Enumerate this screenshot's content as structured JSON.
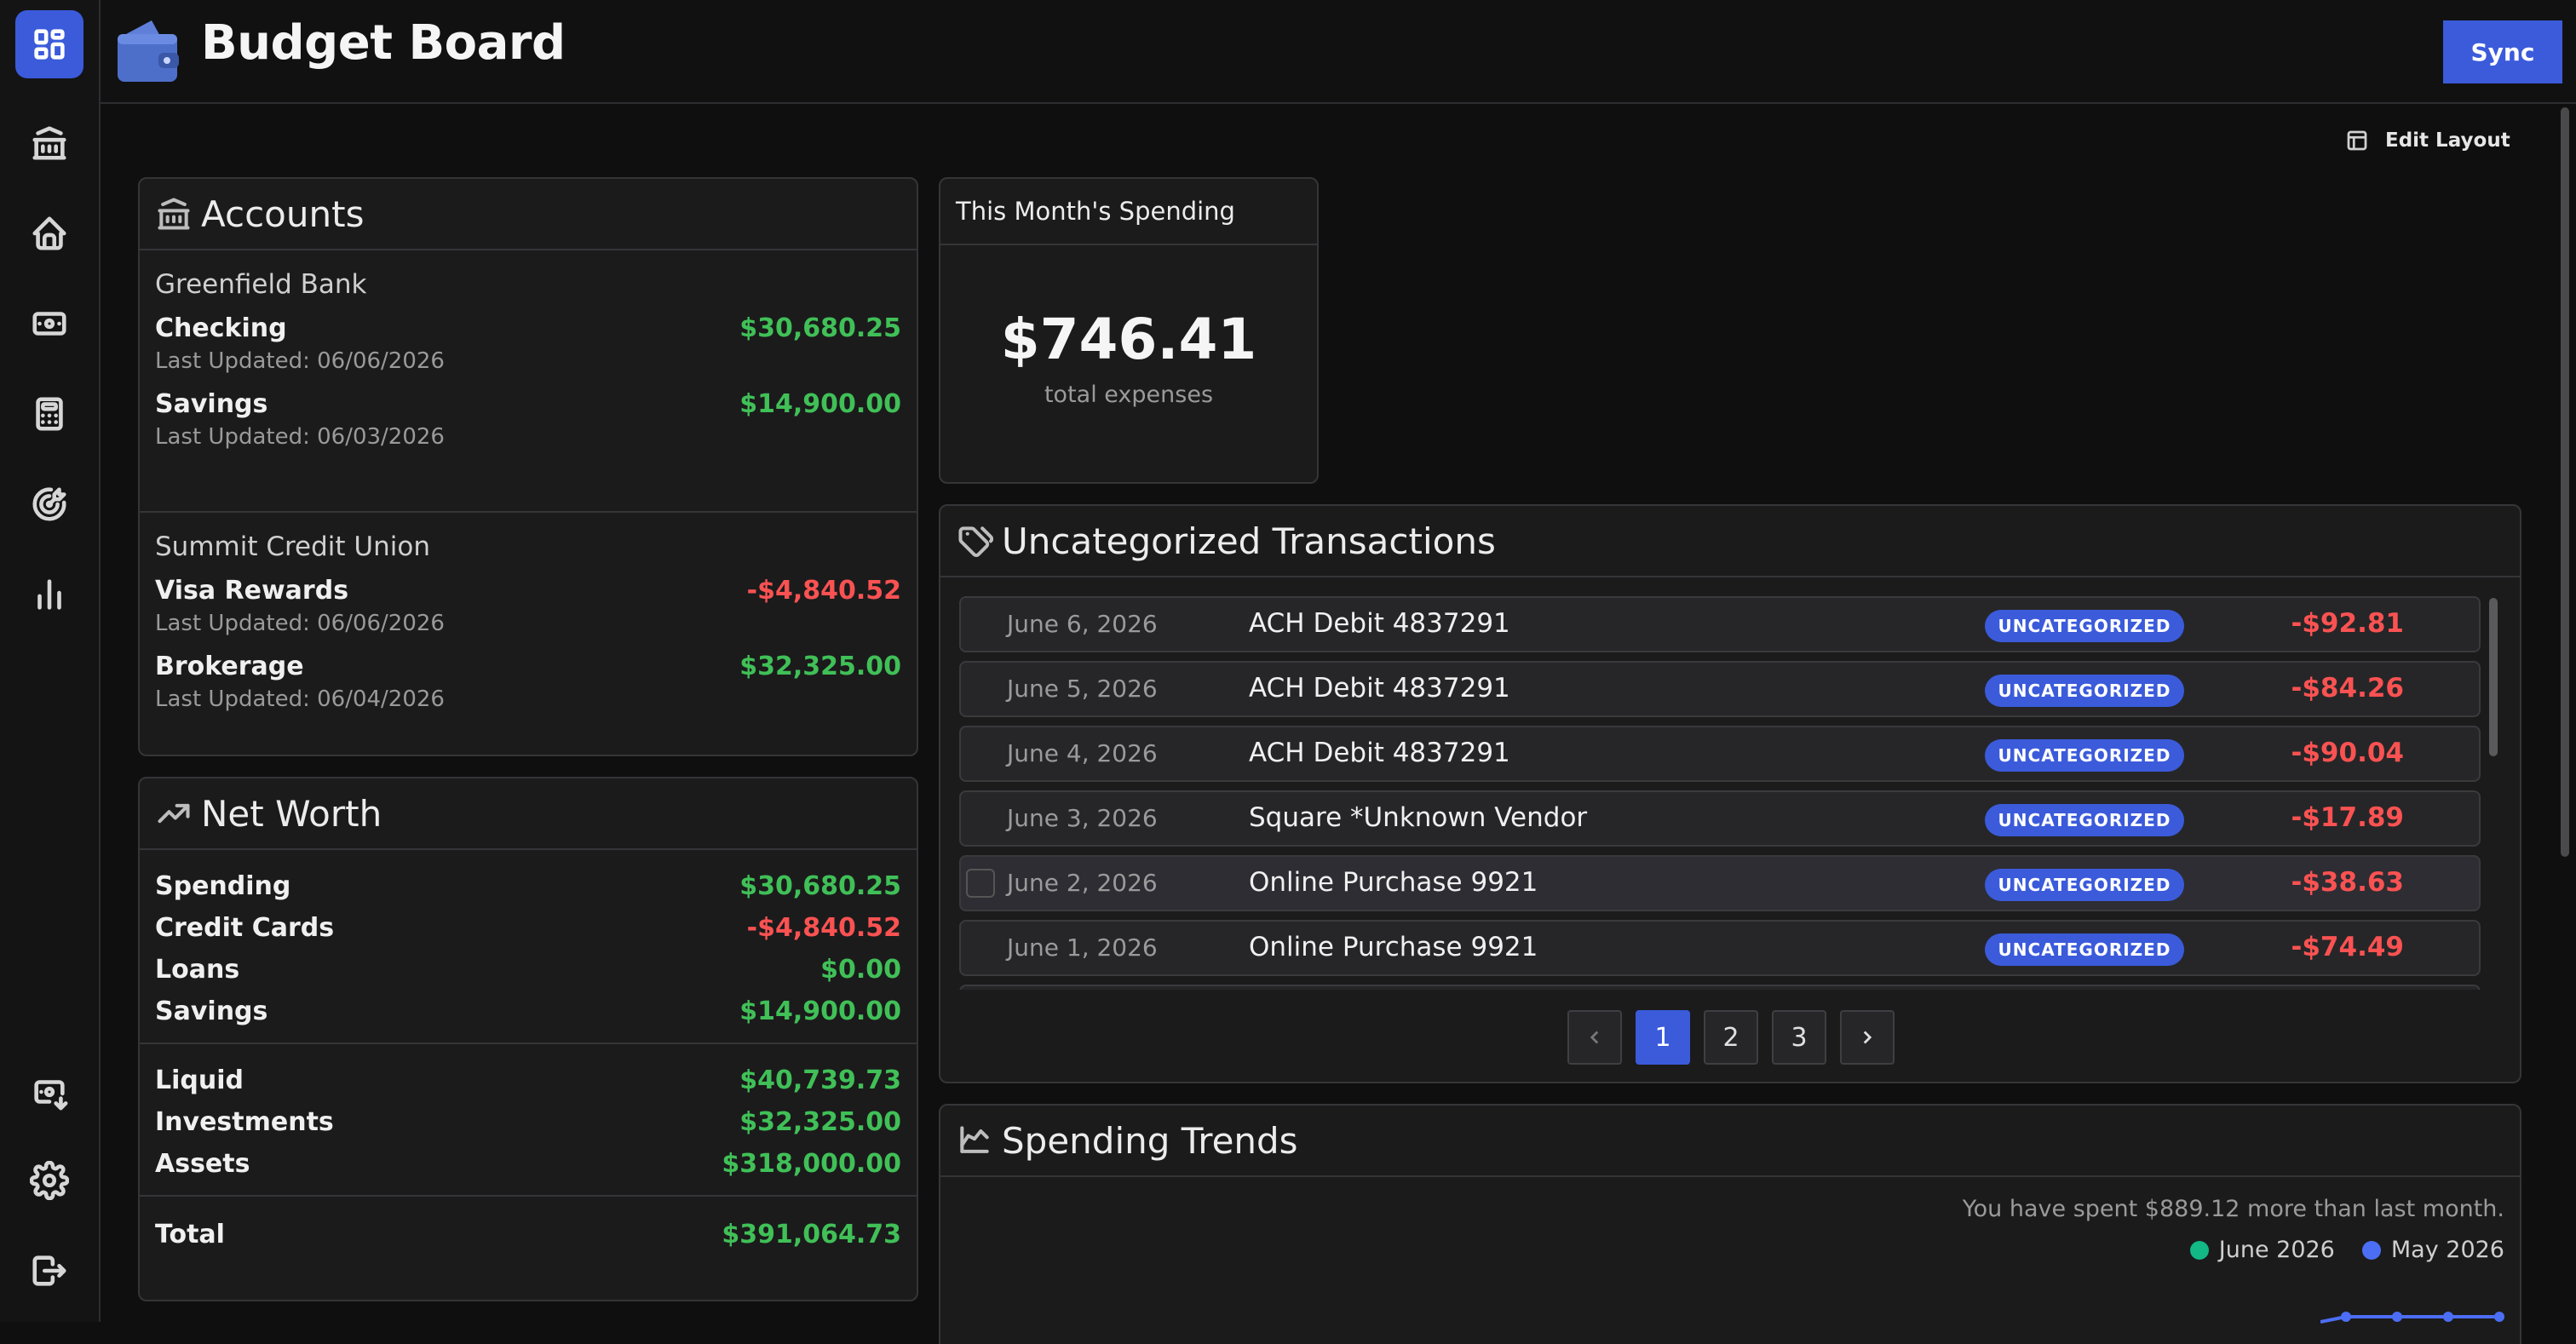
{
  "app": {
    "title": "Budget Board",
    "sync_label": "Sync",
    "edit_layout_label": "Edit Layout"
  },
  "colors": {
    "accent": "#3b5bdb",
    "positive": "#40c057",
    "negative": "#fa5252",
    "june_series": "#12b886",
    "may_series": "#4c6ef5"
  },
  "sidebar": {
    "items": [
      {
        "icon": "dashboard-icon",
        "active": true
      },
      {
        "icon": "bank-icon"
      },
      {
        "icon": "home-icon"
      },
      {
        "icon": "cash-icon"
      },
      {
        "icon": "calculator-icon"
      },
      {
        "icon": "target-icon"
      },
      {
        "icon": "bar-chart-icon"
      }
    ],
    "bottom_items": [
      {
        "icon": "cash-import-icon"
      },
      {
        "icon": "settings-icon"
      },
      {
        "icon": "logout-icon"
      }
    ]
  },
  "accounts": {
    "title": "Accounts",
    "groups": [
      {
        "bank": "Greenfield Bank",
        "accounts": [
          {
            "name": "Checking",
            "amount": "$30,680.25",
            "updated": "Last Updated: 06/06/2026"
          },
          {
            "name": "Savings",
            "amount": "$14,900.00",
            "updated": "Last Updated: 06/03/2026"
          }
        ]
      },
      {
        "bank": "Summit Credit Union",
        "accounts": [
          {
            "name": "Visa Rewards",
            "amount": "-$4,840.52",
            "updated": "Last Updated: 06/06/2026"
          },
          {
            "name": "Brokerage",
            "amount": "$32,325.00",
            "updated": "Last Updated: 06/04/2026"
          }
        ]
      }
    ]
  },
  "net_worth": {
    "title": "Net Worth",
    "section1": [
      {
        "label": "Spending",
        "value": "$30,680.25"
      },
      {
        "label": "Credit Cards",
        "value": "-$4,840.52"
      },
      {
        "label": "Loans",
        "value": "$0.00"
      },
      {
        "label": "Savings",
        "value": "$14,900.00"
      }
    ],
    "section2": [
      {
        "label": "Liquid",
        "value": "$40,739.73"
      },
      {
        "label": "Investments",
        "value": "$32,325.00"
      },
      {
        "label": "Assets",
        "value": "$318,000.00"
      }
    ],
    "total": {
      "label": "Total",
      "value": "$391,064.73"
    }
  },
  "month_spending": {
    "title": "This Month's Spending",
    "value": "$746.41",
    "subtitle": "total expenses"
  },
  "uncategorized": {
    "title": "Uncategorized Transactions",
    "badge": "UNCATEGORIZED",
    "rows": [
      {
        "date": "June 6, 2026",
        "desc": "ACH Debit 4837291",
        "amount": "-$92.81"
      },
      {
        "date": "June 5, 2026",
        "desc": "ACH Debit 4837291",
        "amount": "-$84.26"
      },
      {
        "date": "June 4, 2026",
        "desc": "ACH Debit 4837291",
        "amount": "-$90.04"
      },
      {
        "date": "June 3, 2026",
        "desc": "Square *Unknown Vendor",
        "amount": "-$17.89"
      },
      {
        "date": "June 2, 2026",
        "desc": "Online Purchase 9921",
        "amount": "-$38.63"
      },
      {
        "date": "June 1, 2026",
        "desc": "Online Purchase 9921",
        "amount": "-$74.49"
      }
    ],
    "pages": [
      "1",
      "2",
      "3"
    ],
    "current_page": "1"
  },
  "spending_trends": {
    "title": "Spending Trends",
    "note": "You have spent $889.12 more than last month.",
    "legend": [
      {
        "name": "June 2026"
      },
      {
        "name": "May 2026"
      }
    ]
  }
}
